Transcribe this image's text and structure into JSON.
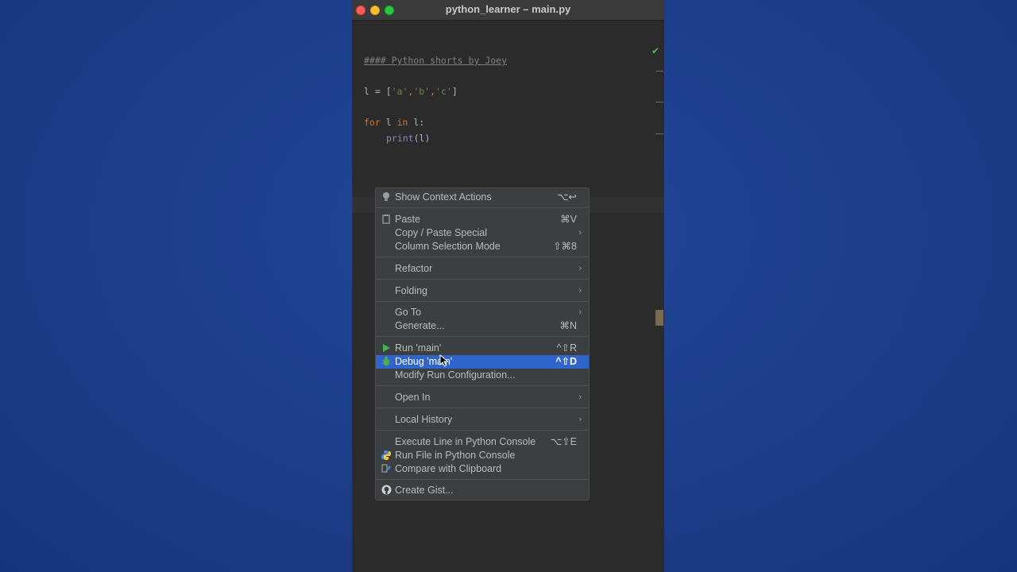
{
  "window": {
    "title": "python_learner – main.py"
  },
  "editor": {
    "line1": "#### Python shorts by Joey",
    "line2": {
      "a": "l = [",
      "s1": "'a'",
      "c1": ",",
      "s2": "'b'",
      "c2": ",",
      "s3": "'c'",
      "b": "]"
    },
    "line3": {
      "kw1": "for",
      "v": " l ",
      "kw2": "in",
      "e": " l:"
    },
    "line4": {
      "fn": "print",
      "e": "(l)"
    }
  },
  "menu": {
    "items": [
      {
        "label": "Show Context Actions",
        "shortcut": "⌥↩"
      },
      {
        "label": "Paste",
        "shortcut": "⌘V"
      },
      {
        "label": "Copy / Paste Special",
        "arrow": "›"
      },
      {
        "label": "Column Selection Mode",
        "shortcut": "⇧⌘8"
      },
      {
        "label": "Refactor",
        "arrow": "›"
      },
      {
        "label": "Folding",
        "arrow": "›"
      },
      {
        "label": "Go To",
        "arrow": "›"
      },
      {
        "label": "Generate...",
        "shortcut": "⌘N"
      },
      {
        "label": "Run 'main'",
        "shortcut": "^⇧R"
      },
      {
        "label": "Debug 'main'",
        "shortcut": "^⇧D"
      },
      {
        "label": "Modify Run Configuration...",
        "shortcut": ""
      },
      {
        "label": "Open In",
        "arrow": "›"
      },
      {
        "label": "Local History",
        "arrow": "›"
      },
      {
        "label": "Execute Line in Python Console",
        "shortcut": "⌥⇧E"
      },
      {
        "label": "Run File in Python Console",
        "shortcut": ""
      },
      {
        "label": "Compare with Clipboard",
        "shortcut": ""
      },
      {
        "label": "Create Gist...",
        "shortcut": ""
      }
    ]
  },
  "colors": {
    "selection": "#2f65ca",
    "run": "#4caf50",
    "menu_bg": "#3c3f41"
  }
}
